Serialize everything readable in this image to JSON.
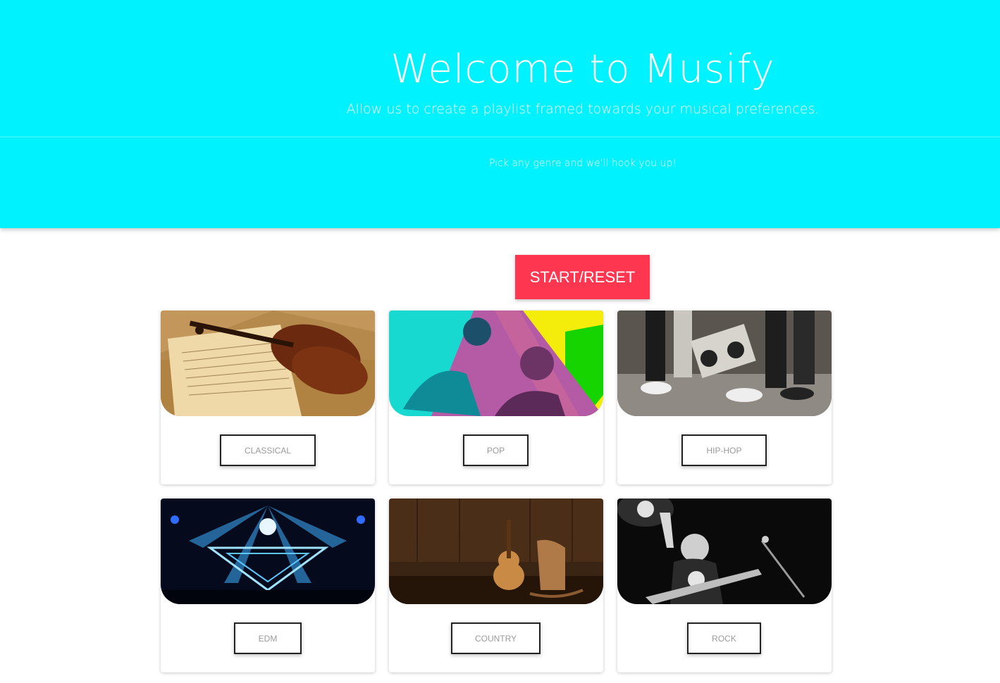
{
  "hero": {
    "title": "Welcome to Musify",
    "subtitle": "Allow us to create a playlist framed towards your musical preferences.",
    "hint": "Pick any genre and we'll hook you up!"
  },
  "controls": {
    "start_reset_label": "START/RESET"
  },
  "genres": [
    {
      "label": "CLASSICAL",
      "image": "violin-sheet-music-image"
    },
    {
      "label": "POP",
      "image": "pop-artists-collage-image"
    },
    {
      "label": "HIP-HOP",
      "image": "boombox-sneakers-image"
    },
    {
      "label": "EDM",
      "image": "dj-stage-lights-image"
    },
    {
      "label": "COUNTRY",
      "image": "guitar-rocking-chair-image"
    },
    {
      "label": "ROCK",
      "image": "rock-guitarist-image"
    }
  ],
  "colors": {
    "hero_bg": "#00f2fe",
    "accent": "#fe3650"
  }
}
